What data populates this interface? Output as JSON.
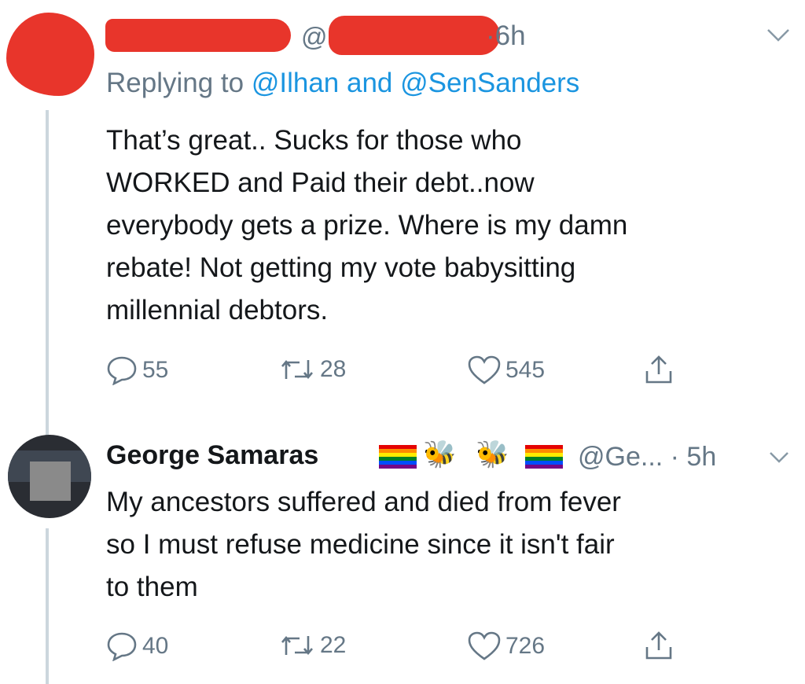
{
  "tweets": [
    {
      "at_symbol": "@",
      "time": "·6h",
      "replying_prefix": "Replying to ",
      "mention1": "@Ilhan",
      "and_word": " and ",
      "mention2": "@SenSanders",
      "text": "That’s great.. Sucks for those who\nWORKED and Paid their debt..now\neverybody gets a prize. Where is my damn\nrebate! Not getting my vote babysitting\nmillennial debtors.",
      "replies": "55",
      "retweets": "28",
      "likes": "545"
    },
    {
      "name": "George Samaras",
      "emoji": "🐝",
      "handle_time": "@Ge... · 5h",
      "text": "My ancestors suffered and died from fever\nso I must refuse medicine since it isn't fair\nto them",
      "replies": "40",
      "retweets": "22",
      "likes": "726"
    }
  ],
  "colors": {
    "redaction": "#e8352b",
    "link": "#1b95e0",
    "secondary": "#657786",
    "thread_line": "#ccd6dd"
  },
  "icons": [
    "reply-icon",
    "retweet-icon",
    "like-icon",
    "share-icon",
    "chevron-down-icon",
    "rainbow-flag-icon",
    "bee-icon"
  ]
}
